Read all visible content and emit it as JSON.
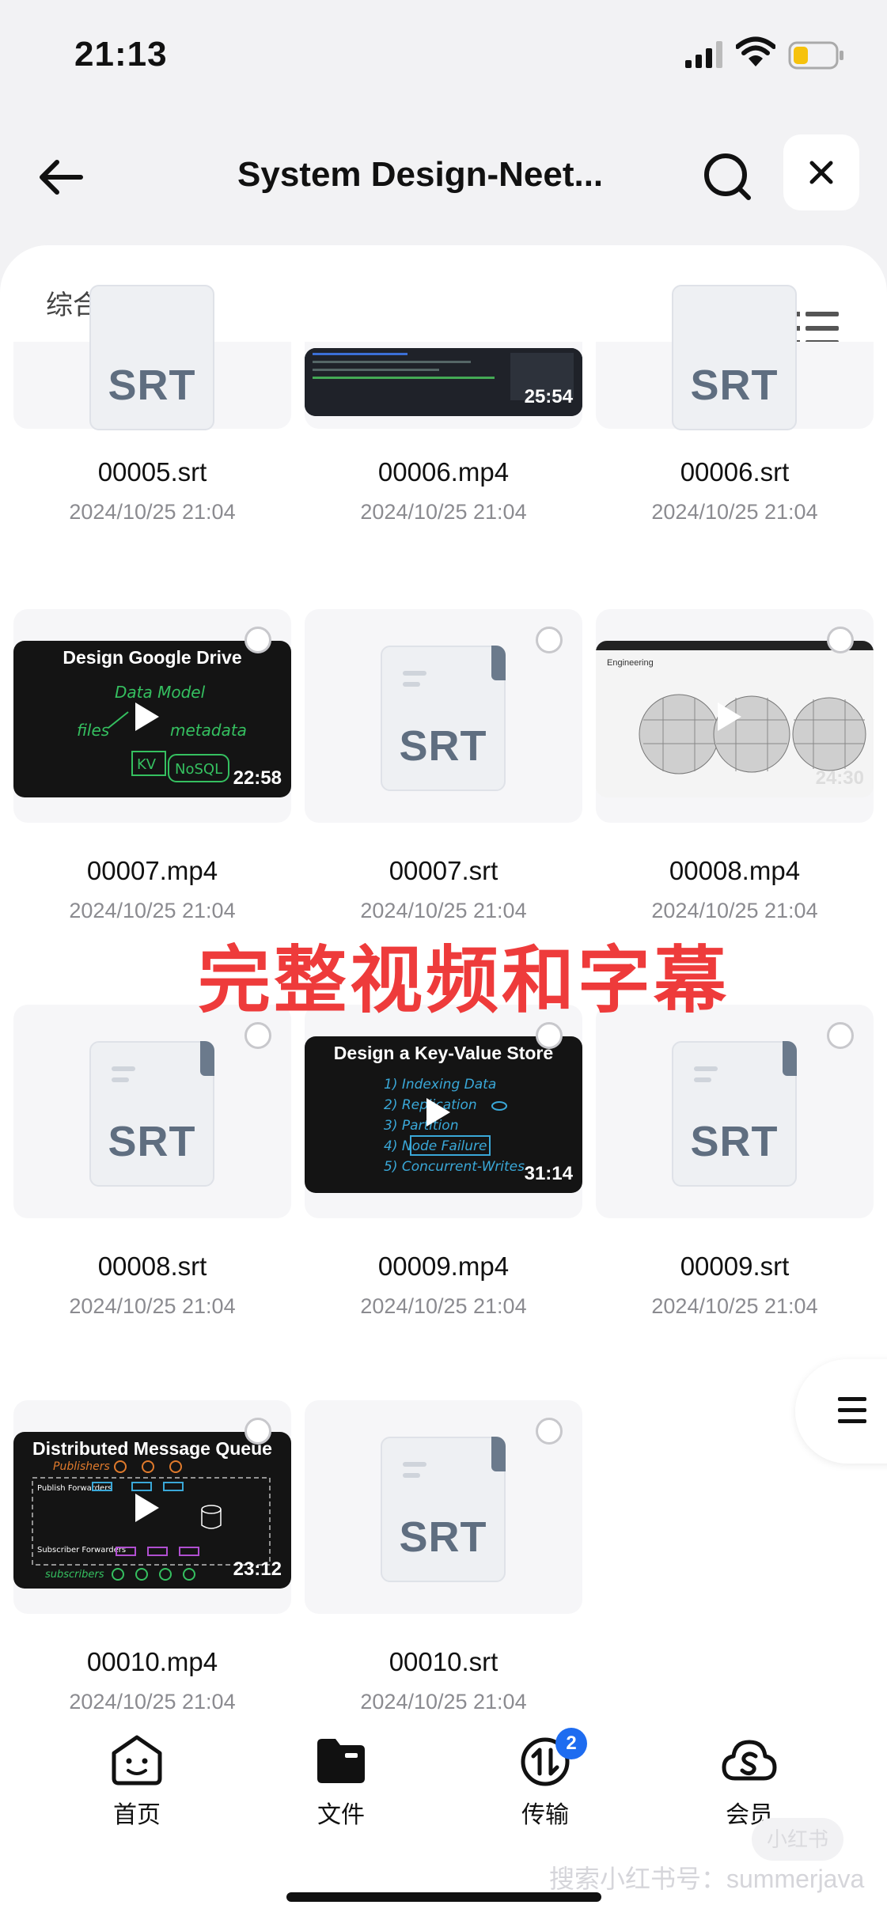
{
  "status": {
    "time": "21:13"
  },
  "nav": {
    "title": "System Design-Neet..."
  },
  "sort": {
    "label": "综合排序"
  },
  "overlay_text": "完整视频和字幕",
  "files": {
    "r0c0": {
      "name": "00005.srt",
      "date": "2024/10/25 21:04",
      "icon_text": "SRT"
    },
    "r0c1": {
      "name": "00006.mp4",
      "date": "2024/10/25 21:04",
      "duration": "25:54"
    },
    "r0c2": {
      "name": "00006.srt",
      "date": "2024/10/25 21:04",
      "icon_text": "SRT"
    },
    "r1c0": {
      "name": "00007.mp4",
      "date": "2024/10/25 21:04",
      "duration": "22:58",
      "thumb_title": "Design Google Drive"
    },
    "r1c1": {
      "name": "00007.srt",
      "date": "2024/10/25 21:04",
      "icon_text": "SRT"
    },
    "r1c2": {
      "name": "00008.mp4",
      "date": "2024/10/25 21:04",
      "duration": "24:30",
      "thumb_title": "Engineering"
    },
    "r2c0": {
      "name": "00008.srt",
      "date": "2024/10/25 21:04",
      "icon_text": "SRT"
    },
    "r2c1": {
      "name": "00009.mp4",
      "date": "2024/10/25 21:04",
      "duration": "31:14",
      "thumb_title": "Design a Key-Value Store"
    },
    "r2c2": {
      "name": "00009.srt",
      "date": "2024/10/25 21:04",
      "icon_text": "SRT"
    },
    "r3c0": {
      "name": "00010.mp4",
      "date": "2024/10/25 21:04",
      "duration": "23:12",
      "thumb_title": "Distributed Message Queue"
    },
    "r3c1": {
      "name": "00010.srt",
      "date": "2024/10/25 21:04",
      "icon_text": "SRT"
    }
  },
  "tabs": {
    "home": "首页",
    "files": "文件",
    "transfer": "传输",
    "member": "会员",
    "transfer_badge": "2"
  },
  "watermark": "搜索小红书号：summerjava",
  "colors": {
    "accent_red": "#ee3b3b",
    "badge_blue": "#1e6cf0",
    "battery_yellow": "#f6c20d"
  }
}
